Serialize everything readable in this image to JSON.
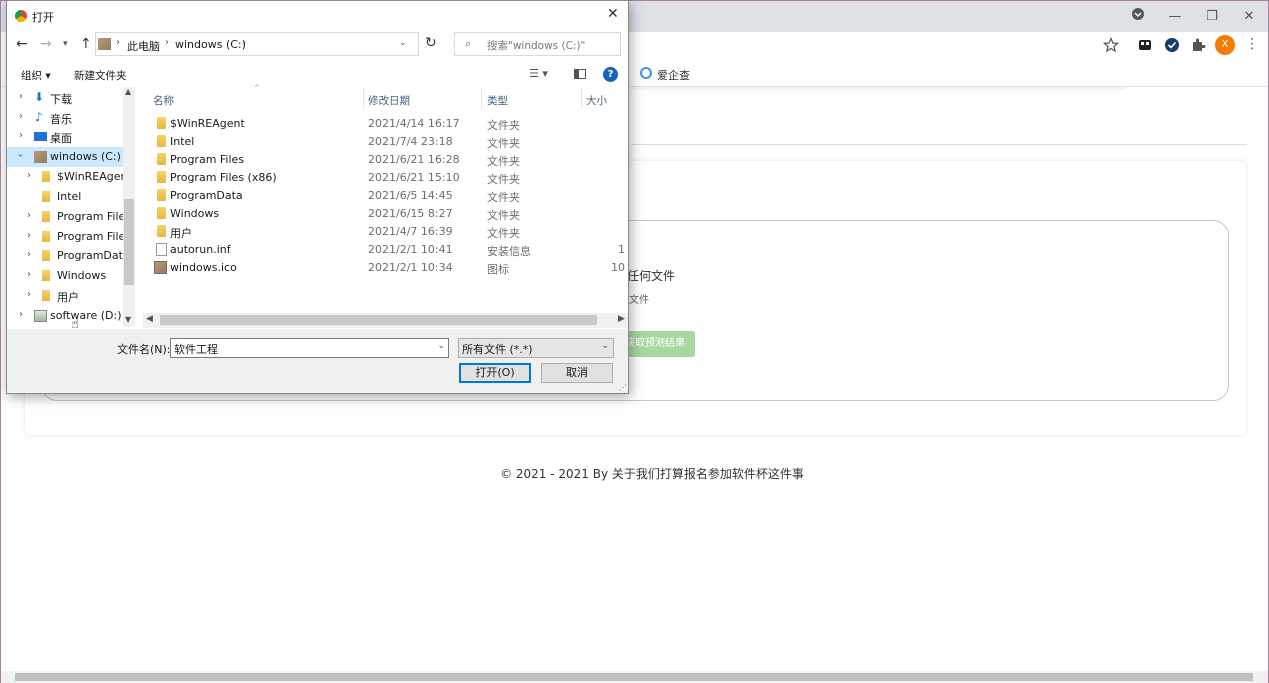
{
  "browser": {
    "bookmark_label": "爱企查",
    "profile_initial": "X",
    "colors": {
      "accent": "#f57c00",
      "titlebar": "#dee1e6"
    }
  },
  "page": {
    "upload_text_partial": "任何文件",
    "upload_subtext_partial": "文件",
    "predict_button_partial": "获取预测结果",
    "footer": "© 2021 - 2021 By 关于我们打算报名参加软件杯这件事"
  },
  "dialog": {
    "title": "打开",
    "breadcrumb": [
      "此电脑",
      "windows (C:)"
    ],
    "search_placeholder": "搜索\"windows (C:)\"",
    "toolbar": {
      "organize": "组织 ▾",
      "new_folder": "新建文件夹"
    },
    "nav_items": [
      {
        "label": "下载",
        "icon": "download-arrow-icon"
      },
      {
        "label": "音乐",
        "icon": "music-note-icon"
      },
      {
        "label": "桌面",
        "icon": "desktop-icon"
      },
      {
        "label": "windows (C:)",
        "icon": "drive-icon",
        "selected": true
      },
      {
        "label": "$WinREAgent",
        "icon": "folder-icon"
      },
      {
        "label": "Intel",
        "icon": "folder-icon"
      },
      {
        "label": "Program Files",
        "icon": "folder-icon"
      },
      {
        "label": "Program Files",
        "icon": "folder-icon"
      },
      {
        "label": "ProgramData",
        "icon": "folder-icon"
      },
      {
        "label": "Windows",
        "icon": "folder-icon"
      },
      {
        "label": "用户",
        "icon": "folder-icon"
      },
      {
        "label": "software (D:)",
        "icon": "drive-icon"
      }
    ],
    "columns": {
      "name": "名称",
      "date": "修改日期",
      "type": "类型",
      "size": "大小"
    },
    "files": [
      {
        "name": "$WinREAgent",
        "date": "2021/4/14 16:17",
        "type": "文件夹",
        "size": "",
        "icon": "folder"
      },
      {
        "name": "Intel",
        "date": "2021/7/4 23:18",
        "type": "文件夹",
        "size": "",
        "icon": "folder"
      },
      {
        "name": "Program Files",
        "date": "2021/6/21 16:28",
        "type": "文件夹",
        "size": "",
        "icon": "folder"
      },
      {
        "name": "Program Files (x86)",
        "date": "2021/6/21 15:10",
        "type": "文件夹",
        "size": "",
        "icon": "folder"
      },
      {
        "name": "ProgramData",
        "date": "2021/6/5 14:45",
        "type": "文件夹",
        "size": "",
        "icon": "folder"
      },
      {
        "name": "Windows",
        "date": "2021/6/15 8:27",
        "type": "文件夹",
        "size": "",
        "icon": "folder"
      },
      {
        "name": "用户",
        "date": "2021/4/7 16:39",
        "type": "文件夹",
        "size": "",
        "icon": "folder"
      },
      {
        "name": "autorun.inf",
        "date": "2021/2/1 10:41",
        "type": "安装信息",
        "size": "1",
        "icon": "file"
      },
      {
        "name": "windows.ico",
        "date": "2021/2/1 10:34",
        "type": "图标",
        "size": "10",
        "icon": "image"
      }
    ],
    "filename_label": "文件名(N):",
    "filename_value": "软件工程",
    "filter_value": "所有文件 (*.*)",
    "open_label": "打开(O)",
    "cancel_label": "取消"
  }
}
